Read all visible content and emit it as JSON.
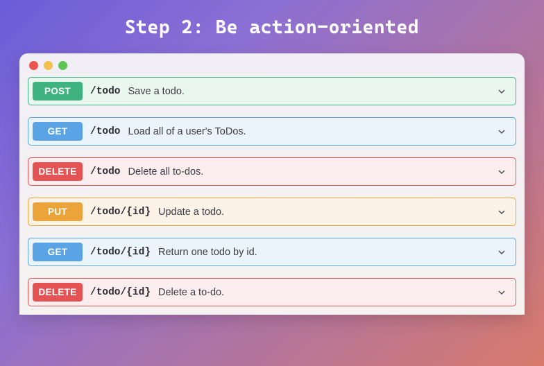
{
  "title": "Step 2: Be action-oriented",
  "endpoints": [
    {
      "method": "POST",
      "methodClass": "post",
      "path": "/todo",
      "description": "Save a todo."
    },
    {
      "method": "GET",
      "methodClass": "get",
      "path": "/todo",
      "description": "Load all of a user's ToDos."
    },
    {
      "method": "DELETE",
      "methodClass": "delete",
      "path": "/todo",
      "description": "Delete all to-dos."
    },
    {
      "method": "PUT",
      "methodClass": "put",
      "path": "/todo/{id}",
      "description": "Update a todo."
    },
    {
      "method": "GET",
      "methodClass": "get",
      "path": "/todo/{id}",
      "description": "Return one todo by id."
    },
    {
      "method": "DELETE",
      "methodClass": "delete",
      "path": "/todo/{id}",
      "description": "Delete a to-do."
    }
  ]
}
